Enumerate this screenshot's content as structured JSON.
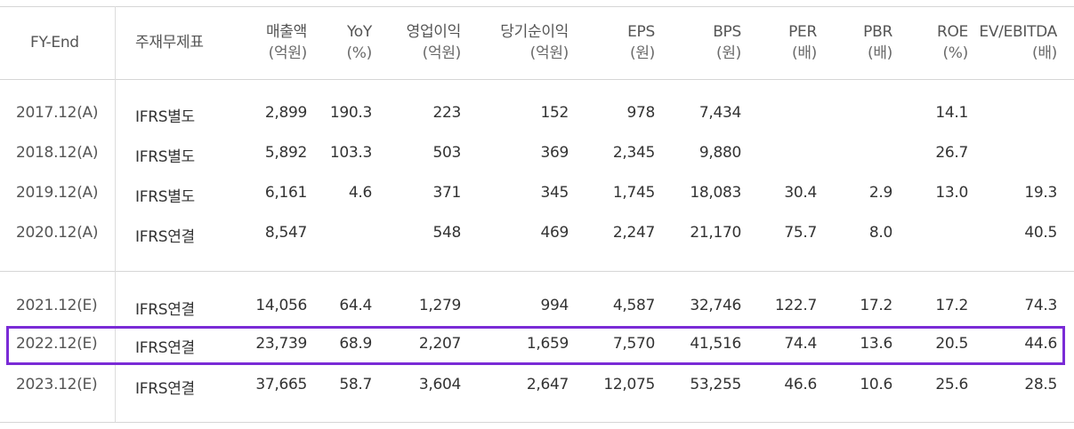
{
  "columns": [
    {
      "key": "fy",
      "label": "FY-End",
      "unit": ""
    },
    {
      "key": "type",
      "label": "주재무제표",
      "unit": ""
    },
    {
      "key": "sales",
      "label": "매출액",
      "unit": "(억원)"
    },
    {
      "key": "yoy",
      "label": "YoY",
      "unit": "(%)"
    },
    {
      "key": "op",
      "label": "영업이익",
      "unit": "(억원)"
    },
    {
      "key": "net",
      "label": "당기순이익",
      "unit": "(억원)"
    },
    {
      "key": "eps",
      "label": "EPS",
      "unit": "(원)"
    },
    {
      "key": "bps",
      "label": "BPS",
      "unit": "(원)"
    },
    {
      "key": "per",
      "label": "PER",
      "unit": "(배)"
    },
    {
      "key": "pbr",
      "label": "PBR",
      "unit": "(배)"
    },
    {
      "key": "roe",
      "label": "ROE",
      "unit": "(%)"
    },
    {
      "key": "ev",
      "label": "EV/EBITDA",
      "unit": "(배)"
    }
  ],
  "rows": [
    [
      "2017.12(A)",
      "IFRS별도",
      "2,899",
      "190.3",
      "223",
      "152",
      "978",
      "7,434",
      "",
      "",
      "14.1",
      ""
    ],
    [
      "2018.12(A)",
      "IFRS별도",
      "5,892",
      "103.3",
      "503",
      "369",
      "2,345",
      "9,880",
      "",
      "",
      "26.7",
      ""
    ],
    [
      "2019.12(A)",
      "IFRS별도",
      "6,161",
      "4.6",
      "371",
      "345",
      "1,745",
      "18,083",
      "30.4",
      "2.9",
      "13.0",
      "19.3"
    ],
    [
      "2020.12(A)",
      "IFRS연결",
      "8,547",
      "",
      "548",
      "469",
      "2,247",
      "21,170",
      "75.7",
      "8.0",
      "",
      "40.5"
    ],
    [
      "2021.12(E)",
      "IFRS연결",
      "14,056",
      "64.4",
      "1,279",
      "994",
      "4,587",
      "32,746",
      "122.7",
      "17.2",
      "17.2",
      "74.3"
    ],
    [
      "2022.12(E)",
      "IFRS연결",
      "23,739",
      "68.9",
      "2,207",
      "1,659",
      "7,570",
      "41,516",
      "74.4",
      "13.6",
      "20.5",
      "44.6"
    ],
    [
      "2023.12(E)",
      "IFRS연결",
      "37,665",
      "58.7",
      "3,604",
      "2,647",
      "12,075",
      "53,255",
      "46.6",
      "10.6",
      "25.6",
      "28.5"
    ]
  ],
  "highlighted_row": 5,
  "colors": {
    "highlight": "#7a2bd6",
    "rule": "#d6d6d6"
  }
}
